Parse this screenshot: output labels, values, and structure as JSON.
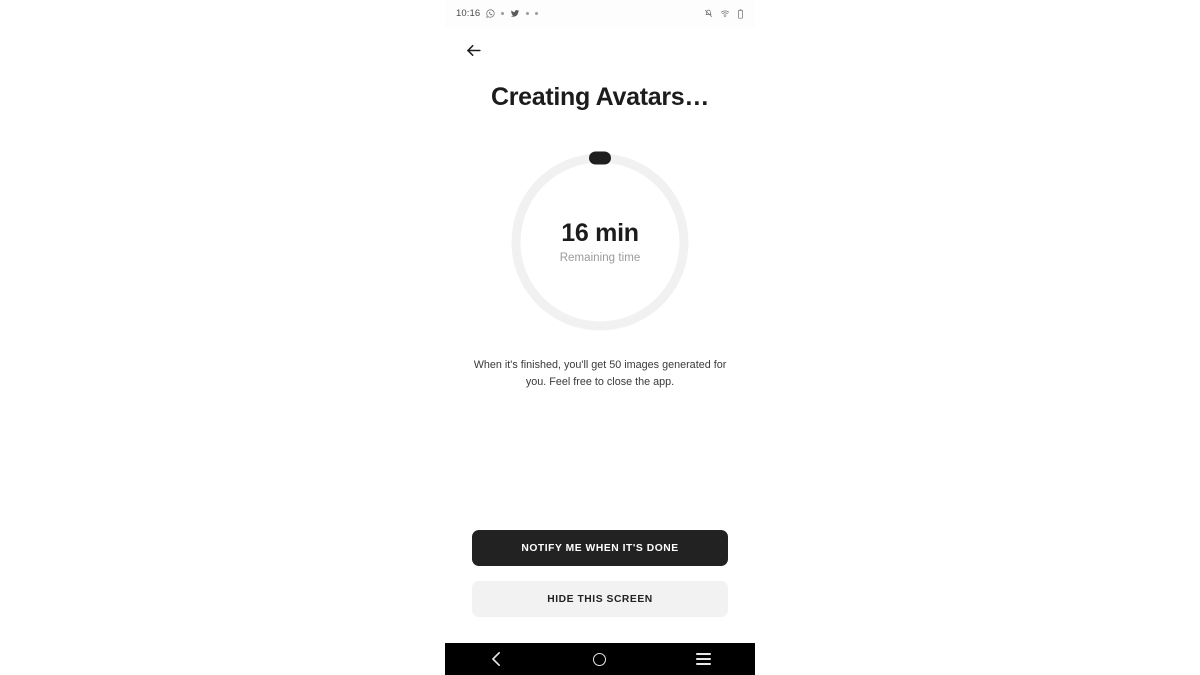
{
  "status_bar": {
    "clock": "10:16",
    "left_icons": [
      "whatsapp-icon",
      "notification-dot-icon",
      "twitter-icon",
      "notification-dot-icon",
      "notification-dot-icon"
    ],
    "right_icons": [
      "vibrate-mode-icon",
      "wifi-icon",
      "battery-icon"
    ]
  },
  "app_bar": {
    "back_icon": "back-arrow-icon"
  },
  "screen": {
    "title": "Creating Avatars…",
    "description": "When it's finished, you'll get 50 images generated for you. Feel free to close the app."
  },
  "progress": {
    "value_text": "16 min",
    "label": "Remaining time",
    "percent": 0,
    "track_color": "#f1f1f1",
    "indicator_color": "#1f1f1f"
  },
  "buttons": {
    "primary_label": "NOTIFY ME WHEN IT'S DONE",
    "primary_bg": "#222222",
    "primary_fg": "#ffffff",
    "secondary_label": "HIDE THIS SCREEN",
    "secondary_bg": "#f2f2f2",
    "secondary_fg": "#222222"
  },
  "nav_bar": {
    "back": "nav-back-icon",
    "home": "nav-home-icon",
    "recents": "nav-recents-icon",
    "background": "#000000"
  }
}
